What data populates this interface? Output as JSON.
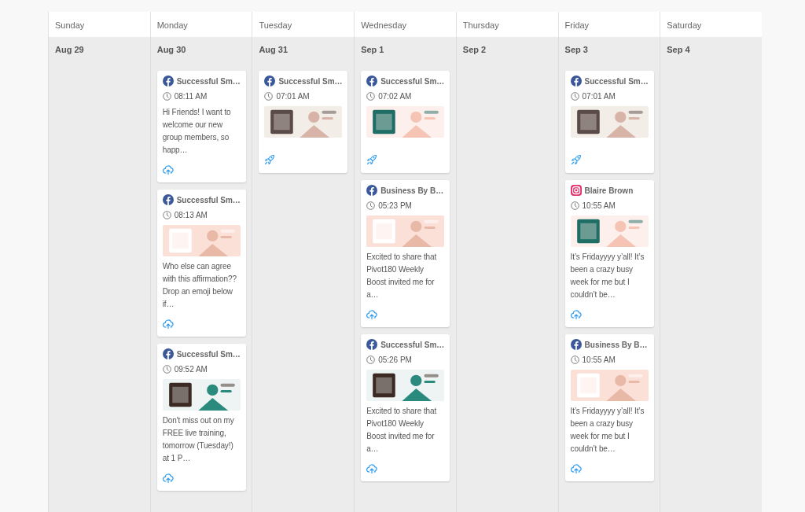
{
  "days": [
    {
      "weekday": "Sunday",
      "date": "Aug 29"
    },
    {
      "weekday": "Monday",
      "date": "Aug 30",
      "posts": [
        {
          "source": {
            "kind": "facebook",
            "account": "Successful Sm…"
          },
          "time": "08:11 AM",
          "text": "Hi Friends! I want to welcome our new group members, so happ…",
          "status": {
            "kind": "upload"
          }
        },
        {
          "source": {
            "kind": "facebook",
            "account": "Successful Sm…"
          },
          "time": "08:13 AM",
          "text": "Who else can agree with this affirmation?? Drop an emoji below if…",
          "status": {
            "kind": "upload"
          }
        },
        {
          "source": {
            "kind": "facebook",
            "account": "Successful Sm…"
          },
          "time": "09:52 AM",
          "text": "Don't miss out on my FREE live training, tomorrow (Tuesday!) at 1 P…",
          "status": {
            "kind": "upload"
          }
        }
      ]
    },
    {
      "weekday": "Tuesday",
      "date": "Aug 31",
      "posts": [
        {
          "source": {
            "kind": "facebook",
            "account": "Successful Sm…"
          },
          "time": "07:01 AM",
          "status": {
            "kind": "rocket"
          }
        }
      ]
    },
    {
      "weekday": "Wednesday",
      "date": "Sep 1",
      "posts": [
        {
          "source": {
            "kind": "facebook",
            "account": "Successful Sm…"
          },
          "time": "07:02 AM",
          "status": {
            "kind": "rocket"
          }
        },
        {
          "source": {
            "kind": "facebook",
            "account": "Business By B…"
          },
          "time": "05:23 PM",
          "text": "Excited to share that Pivot180 Weekly Boost invited me for a…",
          "status": {
            "kind": "upload"
          }
        },
        {
          "source": {
            "kind": "facebook",
            "account": "Successful Sm…"
          },
          "time": "05:26 PM",
          "text": "Excited to share that Pivot180 Weekly Boost invited me for a…",
          "status": {
            "kind": "upload"
          }
        }
      ]
    },
    {
      "weekday": "Thursday",
      "date": "Sep 2"
    },
    {
      "weekday": "Friday",
      "date": "Sep 3",
      "posts": [
        {
          "source": {
            "kind": "facebook",
            "account": "Successful Sm…"
          },
          "time": "07:01 AM",
          "status": {
            "kind": "rocket"
          }
        },
        {
          "source": {
            "kind": "instagram",
            "account": "Blaire Brown"
          },
          "time": "10:55 AM",
          "text": "It’s Fridayyyy y’all! It’s been a crazy busy week for me but I couldn’t be…",
          "status": {
            "kind": "upload"
          }
        },
        {
          "source": {
            "kind": "facebook",
            "account": "Business By B…"
          },
          "time": "10:55 AM",
          "text": "It’s Fridayyyy y’all! It’s been a crazy busy week for me but I couldn’t be…",
          "status": {
            "kind": "upload"
          }
        }
      ]
    },
    {
      "weekday": "Saturday",
      "date": "Sep 4"
    }
  ]
}
